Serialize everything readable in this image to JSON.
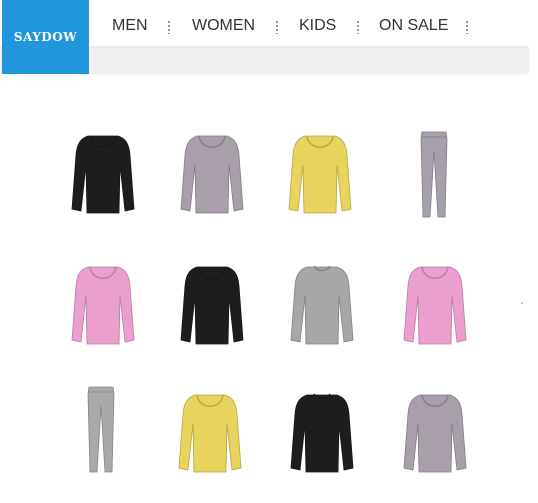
{
  "brand": {
    "name": "SAYDOW",
    "color": "#2196dc"
  },
  "nav": {
    "items": [
      "MEN",
      "WOMEN",
      "KIDS",
      "ON SALE"
    ]
  },
  "products": [
    {
      "kind": "top",
      "neck": "scoop",
      "color": "#1d1d1d"
    },
    {
      "kind": "top",
      "neck": "scoop",
      "color": "#a89fab"
    },
    {
      "kind": "top",
      "neck": "scoop",
      "color": "#e8d35c"
    },
    {
      "kind": "pants",
      "color": "#a69fac"
    },
    {
      "kind": "top",
      "neck": "scoop",
      "color": "#eb9fcf"
    },
    {
      "kind": "top",
      "neck": "scoop",
      "color": "#1d1d1d"
    },
    {
      "kind": "top",
      "neck": "crew",
      "color": "#a7a7a7"
    },
    {
      "kind": "top",
      "neck": "scoop",
      "color": "#eb9fcf"
    },
    {
      "kind": "pants",
      "color": "#a9a9a9"
    },
    {
      "kind": "top",
      "neck": "scoop",
      "color": "#e8d35c"
    },
    {
      "kind": "top",
      "neck": "crew",
      "color": "#1d1d1d"
    },
    {
      "kind": "top",
      "neck": "scoop",
      "color": "#a89fab"
    }
  ]
}
